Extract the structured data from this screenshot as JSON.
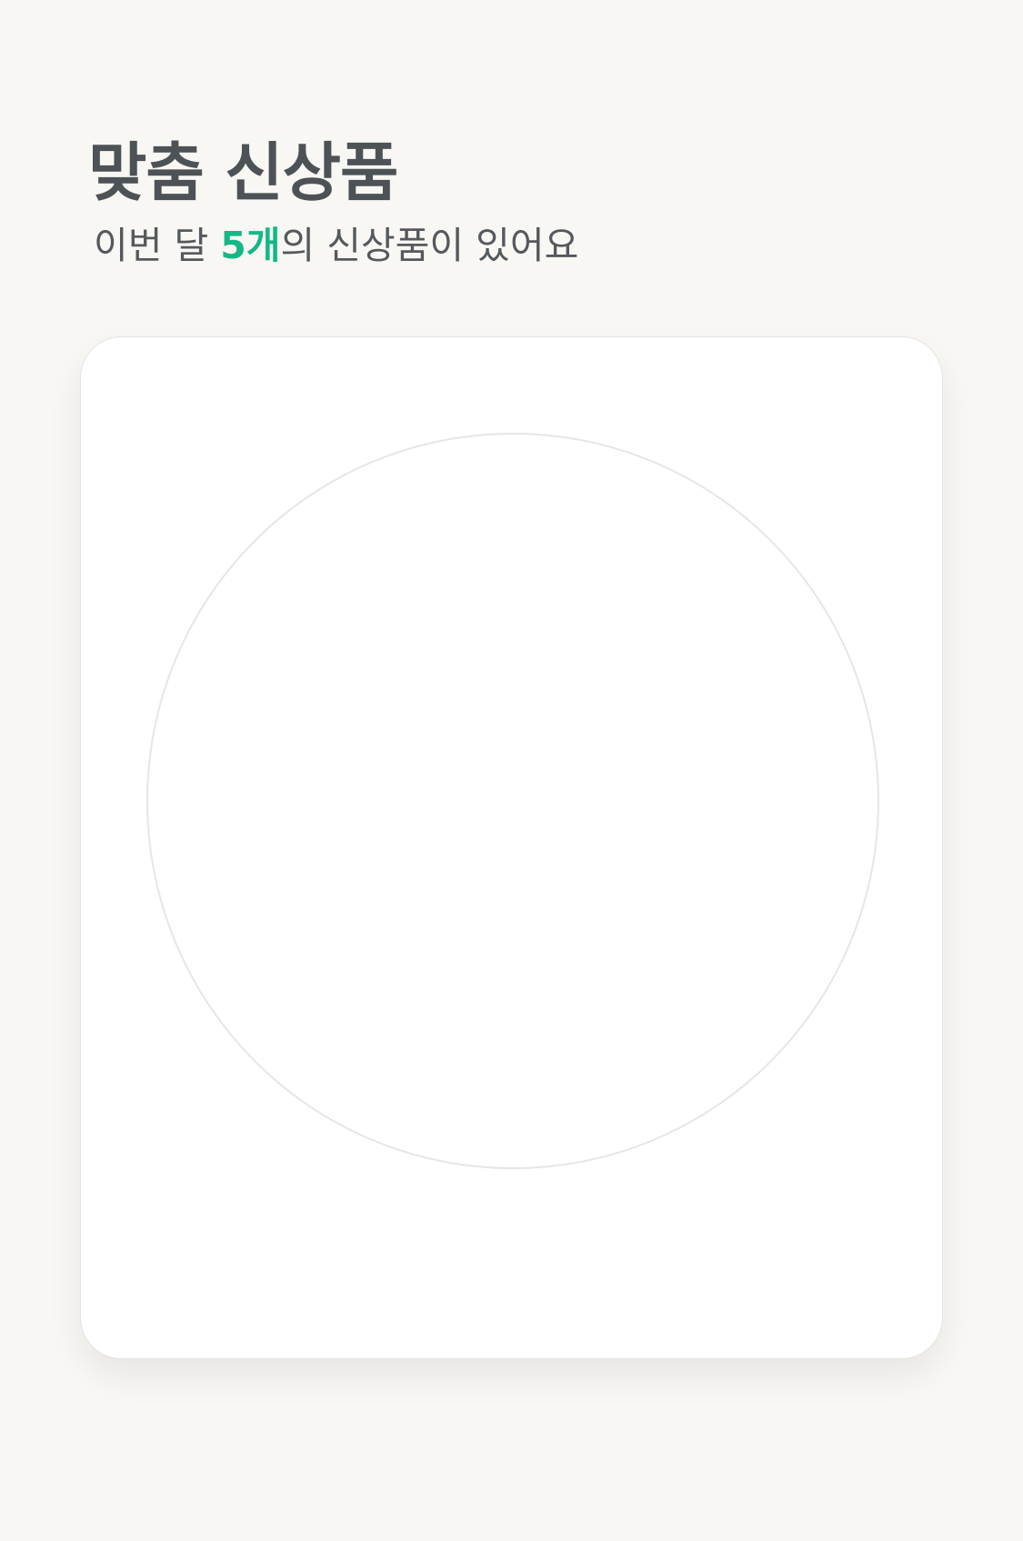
{
  "header": {
    "title": "맞춤 신상품",
    "subtitle_prefix": "이번 달 ",
    "subtitle_count": "5개",
    "subtitle_suffix": "의 신상품이 있어요"
  },
  "colors": {
    "background": "#f8f7f3",
    "title_text": "#4d5257",
    "highlight": "#14b887",
    "card_background": "#ffffff"
  }
}
